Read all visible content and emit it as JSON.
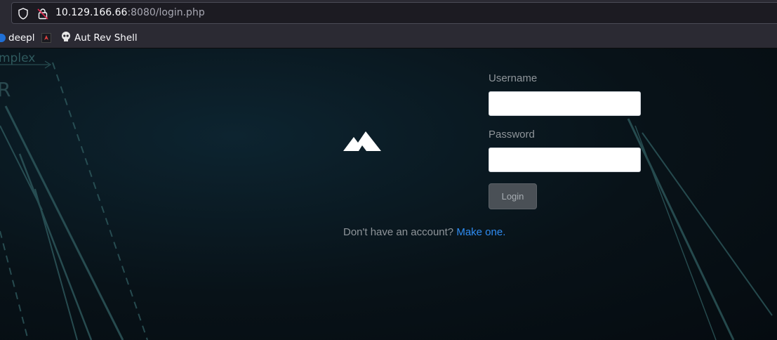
{
  "browser": {
    "url_host": "10.129.166.66",
    "url_rest": ":8080/login.php",
    "bookmarks": [
      {
        "label": "deepl"
      },
      {
        "label": ""
      },
      {
        "label": "Aut Rev Shell"
      }
    ]
  },
  "background": {
    "watermark_text_1": "mplex",
    "watermark_text_2": "R"
  },
  "login": {
    "username_label": "Username",
    "username_value": "",
    "password_label": "Password",
    "password_value": "",
    "login_button": "Login",
    "signup_prompt": "Don't have an account?",
    "signup_link": "Make one."
  },
  "colors": {
    "background": "#0a141c",
    "accent_link": "#2f8cf2",
    "button_bg": "#4a5056",
    "label_text": "#8f959a"
  }
}
